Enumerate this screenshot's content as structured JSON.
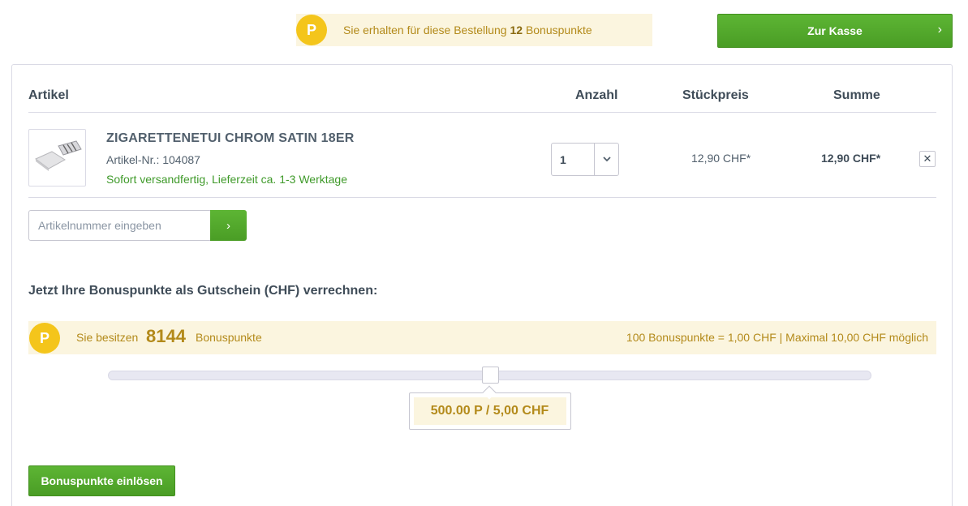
{
  "top_bonus": {
    "badge": "P",
    "text_before": "Sie erhalten für diese Bestellung",
    "points": "12",
    "text_after": "Bonuspunkte"
  },
  "checkout": {
    "label": "Zur Kasse",
    "chevron": "›"
  },
  "table": {
    "headers": {
      "article": "Artikel",
      "quantity": "Anzahl",
      "unit_price": "Stückpreis",
      "total": "Summe"
    }
  },
  "item": {
    "name": "ZIGARETTENETUI CHROM SATIN 18ER",
    "article_number": "Artikel-Nr.: 104087",
    "delivery": "Sofort versandfertig, Lieferzeit ca. 1-3 Werktage",
    "quantity": "1",
    "unit_price": "12,90 CHF*",
    "total": "12,90 CHF*",
    "remove": "✕"
  },
  "article_input": {
    "placeholder": "Artikelnummer eingeben",
    "button": "›"
  },
  "bonus": {
    "heading": "Jetzt Ihre Bonuspunkte als Gutschein (CHF) verrechnen:",
    "badge": "P",
    "have_label": "Sie besitzen",
    "have_value": "8144",
    "have_unit": "Bonuspunkte",
    "rate_info": "100 Bonuspunkte = 1,00 CHF | Maximal 10,00 CHF möglich",
    "slider_fraction": 0.5,
    "slider_value": "500.00 P / 5,00 CHF",
    "redeem_label": "Bonuspunkte einlösen"
  },
  "colors": {
    "accent_green": "#4a9d25",
    "bonus_gold": "#b38a1a",
    "bonus_bg": "#fbf5df",
    "badge_yellow": "#f4c51b"
  },
  "icons": {
    "badge": "bonus-points-icon",
    "chevron": "chevron-right-icon",
    "dropdown": "chevron-down-icon",
    "remove": "close-icon"
  }
}
